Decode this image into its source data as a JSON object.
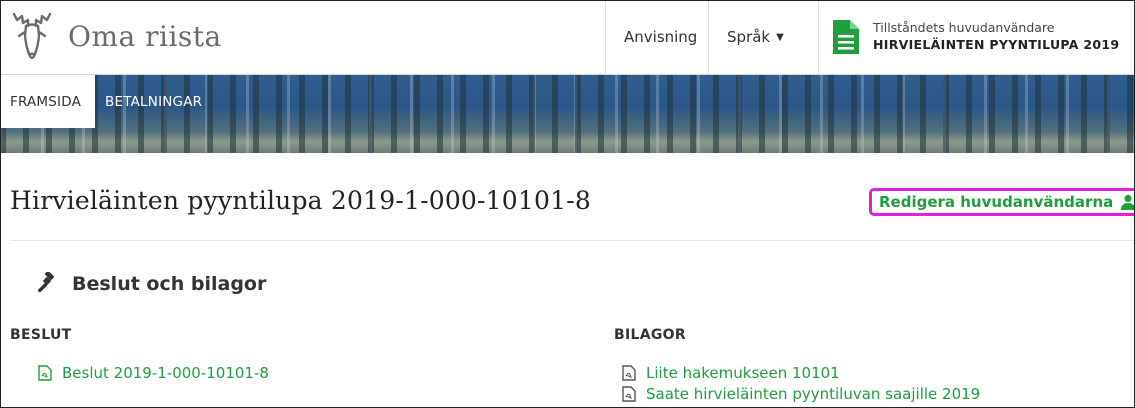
{
  "header": {
    "brand": "Oma riista",
    "nav_guide": "Anvisning",
    "nav_language": "Språk",
    "permit_subtitle": "Tillståndets huvudanvändare",
    "permit_title": "HIRVIELÄINTEN PYYNTILUPA 2019"
  },
  "tabs": [
    {
      "label": "FRAMSIDA",
      "active": true
    },
    {
      "label": "BETALNINGAR",
      "active": false
    }
  ],
  "page": {
    "title": "Hirvieläinten pyyntilupa 2019-1-000-10101-8",
    "edit_link": "Redigera huvudanvändarna"
  },
  "section": {
    "heading": "Beslut och bilagor",
    "left_heading": "BESLUT",
    "right_heading": "BILAGOR",
    "decisions": [
      "Beslut 2019-1-000-10101-8"
    ],
    "attachments": [
      "Liite hakemukseen 10101",
      "Saate hirvieläinten pyyntiluvan saajille 2019"
    ]
  },
  "colors": {
    "accent_green": "#1f9e3c",
    "highlight": "#e020e0",
    "banner_blue": "#2f5f8f"
  },
  "icons": [
    "moose-logo-icon",
    "caret-down-icon",
    "document-icon",
    "user-icon",
    "gavel-icon",
    "pdf-file-icon"
  ]
}
